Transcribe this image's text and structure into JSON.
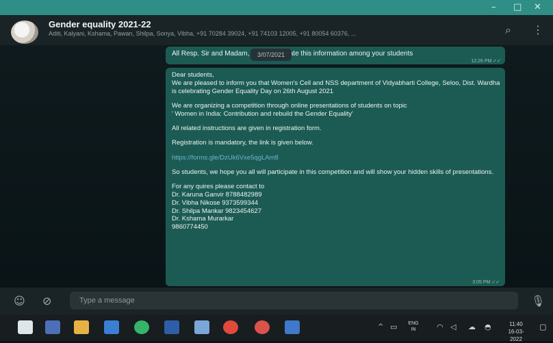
{
  "window": {
    "minimize": "–",
    "maximize": "□",
    "close": "✕"
  },
  "header": {
    "group_title": "Gender equality 2021-22",
    "members": "Aditi, Kalyani, Kshama, Pawan, Shilpa, Sonya, Vibha, +91 70284 39024, +91 74103 12005, +91 80054 60376, ..."
  },
  "messages": [
    {
      "text": "All Resp. Sir and Madam, please circulate this information among your students",
      "time": "12:26 PM ✓✓"
    },
    {
      "paragraphs": [
        [
          "Dear students,",
          "We are pleased to inform you that Women's Cell and NSS department of Vidyabharti College, Seloo, Dist. Wardha is celebrating Gender Equality Day on 26th August 2021"
        ],
        [
          "We are organizing a competition through online presentations of students on topic",
          "' Women in India: Contribution and rebuild the Gender Equality'"
        ],
        [
          "All related instructions are given in registration form."
        ],
        [
          "Registration is mandatory, the link is given below."
        ],
        [
          "https://forms.gle/DzUk6Vxe5qgLAm8"
        ],
        [
          "So students, we hope you all will participate in this competition and will show your hidden skills of presentations."
        ],
        [
          "For any quires please contact to",
          "Dr. Karuna Ganvir 8788482989",
          "Dr. Vibha Nikose 9373599344",
          "Dr. Shilpa Mankar 9823454627",
          "Dr. Kshama Murarkar",
          "9860774450"
        ]
      ],
      "time": "3:05 PM ✓✓"
    }
  ],
  "date_chip": "3/07/2021",
  "composer": {
    "placeholder": "Type a message"
  },
  "taskbar": {
    "lang_top": "ENG",
    "lang_bottom": "IN",
    "time": "11:40",
    "date": "16-03-2022"
  },
  "colors": {
    "titlebar": "#2f8f86",
    "bubble": "#1c5b54",
    "link": "#6ab8c9"
  }
}
